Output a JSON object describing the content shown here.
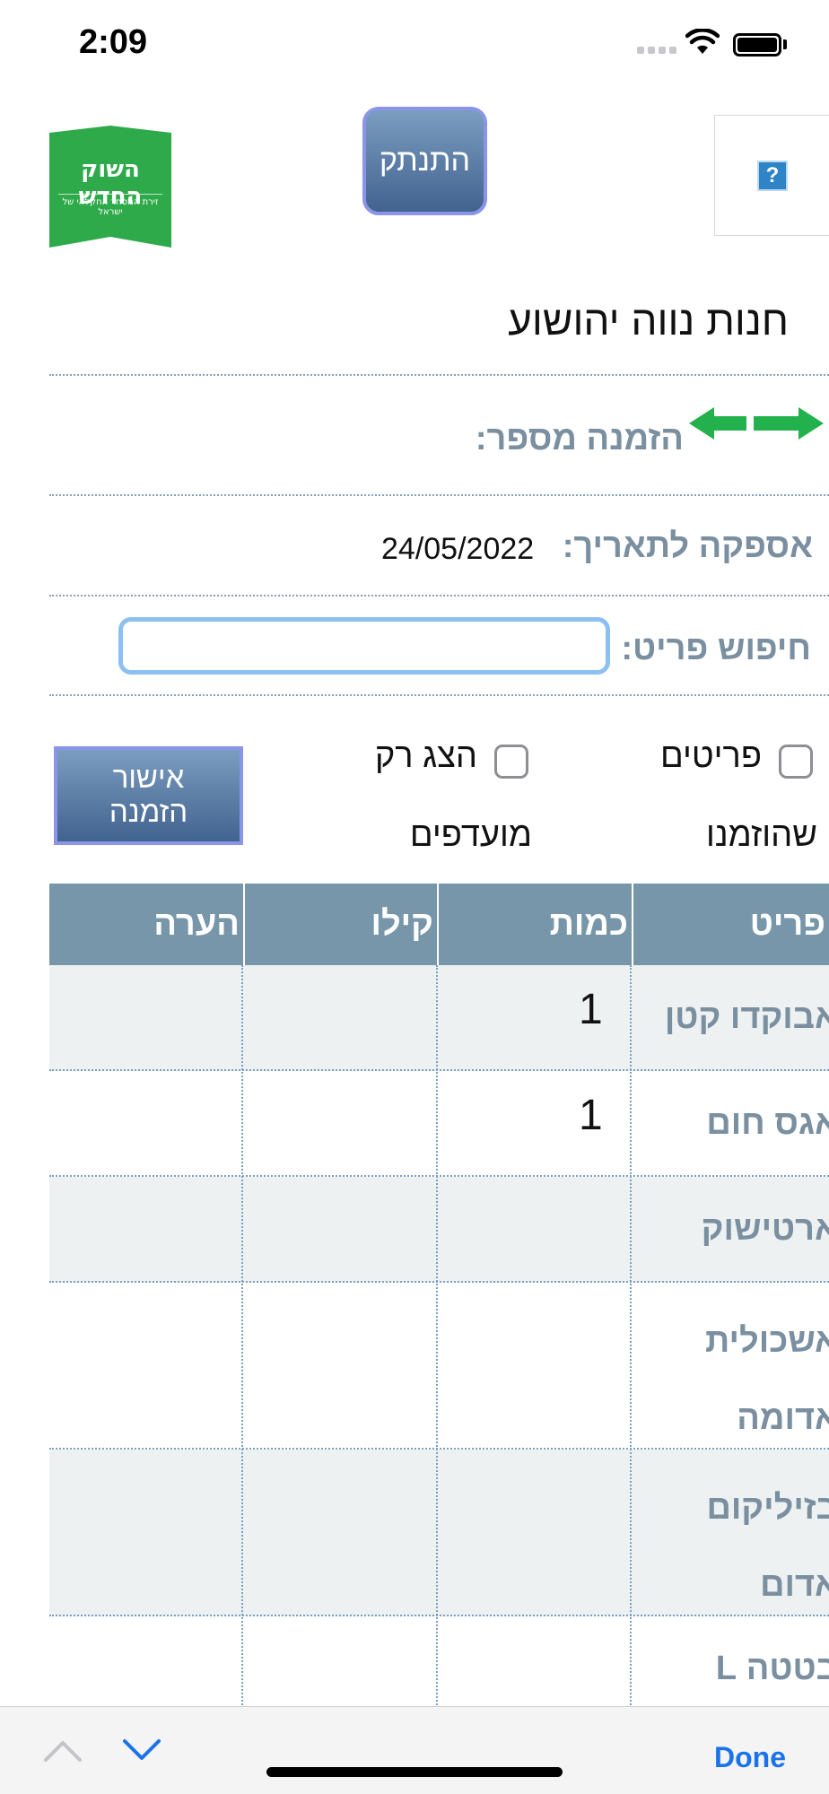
{
  "status_bar": {
    "time": "2:09"
  },
  "header": {
    "logo_title": "השוק החדש",
    "logo_subtitle": "זירת המסחר החקלאי של ישראל",
    "disconnect_label": "התנתק",
    "help_icon_glyph": "?"
  },
  "store": {
    "name": "חנות נווה יהושוע"
  },
  "order": {
    "number_label": "הזמנה מספר:"
  },
  "delivery": {
    "date_label": "אספקה לתאריך:",
    "date_value": "24/05/2022"
  },
  "search": {
    "label": "חיפוש פריט:",
    "value": "",
    "placeholder": ""
  },
  "filters": {
    "ordered_items_line1": "פריטים",
    "ordered_items_line2": "שהוזמנו",
    "ordered_items_checked": false,
    "favorites_line1": "הצג רק",
    "favorites_line2": "מועדפים",
    "favorites_checked": false
  },
  "approve_button": {
    "line1": "אישור",
    "line2": "הזמנה"
  },
  "table": {
    "headers": {
      "item": "פריט",
      "quantity": "כמות",
      "kilo": "קילו",
      "note": "הערה"
    },
    "rows": [
      {
        "item": "אבוקדו קטן",
        "quantity": "1",
        "kilo": "",
        "note": ""
      },
      {
        "item": "אגס חום",
        "quantity": "1",
        "kilo": "",
        "note": ""
      },
      {
        "item": "ארטישוק",
        "quantity": "",
        "kilo": "",
        "note": ""
      },
      {
        "item": "אשכולית אדומה",
        "quantity": "",
        "kilo": "",
        "note": ""
      },
      {
        "item": "בזיליקום אדום",
        "quantity": "",
        "kilo": "",
        "note": ""
      },
      {
        "item": "בטטה L",
        "quantity": "",
        "kilo": "",
        "note": ""
      }
    ]
  },
  "accessory_bar": {
    "done_label": "Done"
  },
  "colors": {
    "header_blue": "#7896aa",
    "label_gray": "#7a8fa0",
    "logo_green": "#2eaa4a",
    "arrow_green": "#23b14d",
    "done_blue": "#1a73e8"
  }
}
